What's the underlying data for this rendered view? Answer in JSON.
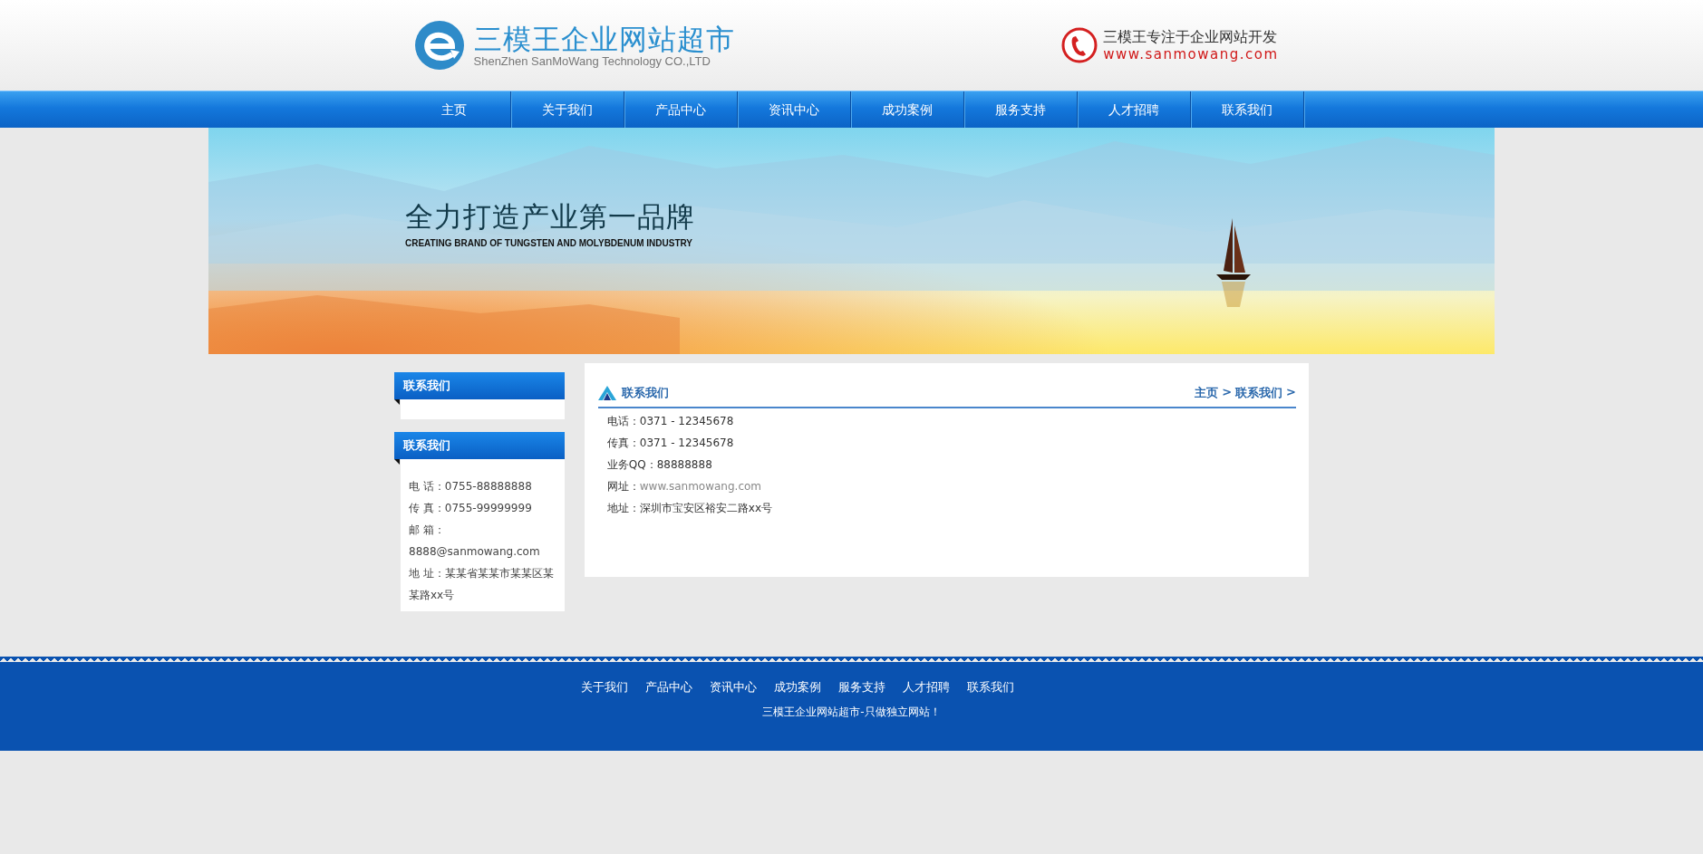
{
  "header": {
    "logo_title": "三模王企业网站超市",
    "logo_subtitle": "ShenZhen SanMoWang  Technology CO.,LTD",
    "slogan": "三模王专注于企业网站开发",
    "url": "www.sanmowang.com"
  },
  "nav": [
    {
      "label": "主页"
    },
    {
      "label": "关于我们"
    },
    {
      "label": "产品中心"
    },
    {
      "label": "资讯中心"
    },
    {
      "label": "成功案例"
    },
    {
      "label": "服务支持"
    },
    {
      "label": "人才招聘"
    },
    {
      "label": "联系我们"
    }
  ],
  "banner": {
    "title": "全力打造产业第一品牌",
    "subtitle": "CREATING BRAND OF TUNGSTEN AND MOLYBDENUM INDUSTRY"
  },
  "sidebar": [
    {
      "title": "联系我们"
    },
    {
      "title": "联系我们",
      "lines": [
        "电 话：0755-88888888",
        "传 真：0755-99999999",
        "邮 箱：8888@sanmowang.com",
        "地 址：某某省某某市某某区某某路xx号"
      ]
    }
  ],
  "content": {
    "title": "联系我们",
    "breadcrumb": {
      "items": [
        "主页",
        "联系我们"
      ],
      "separator": ">"
    },
    "lines": [
      {
        "kind": "text",
        "label": "电话：",
        "value": "0371 - 12345678"
      },
      {
        "kind": "text",
        "label": "传真：",
        "value": "0371 - 12345678"
      },
      {
        "kind": "text",
        "label": "业务QQ：",
        "value": "88888888"
      },
      {
        "kind": "link",
        "label": "网址：",
        "value": "www.sanmowang.com"
      },
      {
        "kind": "text",
        "label": "地址：",
        "value": "深圳市宝安区裕安二路xx号"
      }
    ]
  },
  "footer": {
    "links": [
      "关于我们",
      "产品中心",
      "资讯中心",
      "成功案例",
      "服务支持",
      "人才招聘",
      "联系我们"
    ],
    "tagline": "三模王企业网站超市-只做独立网站！"
  }
}
